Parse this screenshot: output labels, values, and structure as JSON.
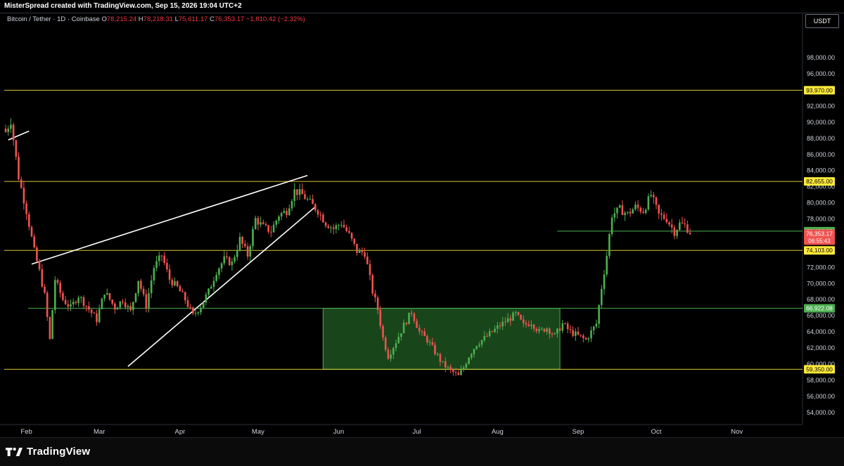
{
  "header": {
    "credit": "MisterSpread created with TradingView.com, Sep 15, 2026 19:04 UTC+2"
  },
  "legend": {
    "symbol": "Bitcoin / Tether · 1D · Coinbase",
    "open_label": "O",
    "open": "78,215.24",
    "high_label": "H",
    "high": "78,218.31",
    "low_label": "L",
    "low": "75,611.17",
    "close_label": "C",
    "close": "76,353.17",
    "change": "−1,810.42 (−2.32%)"
  },
  "currency": "USDT",
  "colors": {
    "up": "#26a69a",
    "up_candle": "#4caf50",
    "down": "#ef5350",
    "level_yellow": "#ffeb3b",
    "level_green": "#4caf50",
    "zone_fill": "#2e7d32",
    "trendline": "#ffffff",
    "background": "#000000",
    "axis_text": "#d1d4dc"
  },
  "chart_data": {
    "type": "candlestick",
    "title": "",
    "y_range": [
      52500,
      101500
    ],
    "y_ticks": [
      "54,000.00",
      "56,000.00",
      "58,000.00",
      "60,000.00",
      "62,000.00",
      "64,000.00",
      "66,000.00",
      "68,000.00",
      "70,000.00",
      "72,000.00",
      "74,000.00",
      "76,000.00",
      "78,000.00",
      "80,000.00",
      "82,000.00",
      "84,000.00",
      "86,000.00",
      "88,000.00",
      "90,000.00",
      "92,000.00",
      "94,000.00",
      "96,000.00",
      "98,000.00"
    ],
    "x_ticks": [
      "Feb",
      "Mar",
      "Apr",
      "May",
      "Jun",
      "Jul",
      "Aug",
      "Sep",
      "Oct",
      "Nov"
    ],
    "price_levels": [
      {
        "label": "93,970.00",
        "value": 93970,
        "color": "yellow"
      },
      {
        "label": "82,655.00",
        "value": 82655,
        "color": "yellow"
      },
      {
        "label": "74,103.00",
        "value": 74103,
        "color": "yellow"
      },
      {
        "label": "66,922.08",
        "value": 66922.08,
        "color": "green"
      },
      {
        "label": "59,350.00",
        "value": 59350,
        "color": "yellow"
      }
    ],
    "horizontal_ray": {
      "label": "76,492.03",
      "value": 76492.03,
      "start_date": "2026-08-24"
    },
    "last_price": {
      "label": "76,353.17",
      "value": 76353.17,
      "countdown": "06:55:43"
    },
    "zone": {
      "start_date": "2026-05-26",
      "end_date": "2026-08-25",
      "low": 59350,
      "high": 66922.08
    },
    "trendlines": [
      {
        "from": {
          "date": "2026-01-25",
          "price": 87800
        },
        "to": {
          "date": "2026-02-02",
          "price": 88900
        }
      },
      {
        "from": {
          "date": "2026-02-03",
          "price": 72400
        },
        "to": {
          "date": "2026-05-20",
          "price": 83400
        }
      },
      {
        "from": {
          "date": "2026-03-12",
          "price": 59700
        },
        "to": {
          "date": "2026-05-23",
          "price": 79500
        }
      }
    ],
    "candles_anchor": {
      "start_date": "2026-01-24"
    },
    "close_anchors": [
      [
        0,
        88800
      ],
      [
        2,
        90200
      ],
      [
        5,
        83200
      ],
      [
        8,
        79000
      ],
      [
        11,
        74000
      ],
      [
        13,
        71500
      ],
      [
        15,
        68500
      ],
      [
        17,
        63000
      ],
      [
        19,
        70500
      ],
      [
        22,
        68000
      ],
      [
        25,
        67000
      ],
      [
        28,
        68500
      ],
      [
        32,
        66800
      ],
      [
        35,
        65500
      ],
      [
        38,
        69000
      ],
      [
        42,
        67000
      ],
      [
        45,
        68000
      ],
      [
        48,
        66500
      ],
      [
        51,
        70500
      ],
      [
        54,
        67200
      ],
      [
        57,
        72000
      ],
      [
        60,
        73500
      ],
      [
        63,
        70500
      ],
      [
        66,
        69500
      ],
      [
        69,
        68000
      ],
      [
        72,
        66000
      ],
      [
        75,
        67200
      ],
      [
        78,
        69000
      ],
      [
        81,
        71500
      ],
      [
        84,
        73000
      ],
      [
        87,
        72500
      ],
      [
        90,
        75500
      ],
      [
        93,
        73500
      ],
      [
        96,
        78000
      ],
      [
        99,
        77000
      ],
      [
        102,
        76500
      ],
      [
        105,
        78500
      ],
      [
        108,
        79000
      ],
      [
        111,
        81500
      ],
      [
        114,
        81000
      ],
      [
        117,
        80000
      ],
      [
        120,
        79000
      ],
      [
        123,
        77500
      ],
      [
        126,
        76800
      ],
      [
        129,
        77500
      ],
      [
        132,
        76000
      ],
      [
        135,
        74000
      ],
      [
        138,
        73800
      ],
      [
        141,
        69000
      ],
      [
        143,
        66800
      ],
      [
        145,
        63200
      ],
      [
        147,
        61000
      ],
      [
        150,
        62800
      ],
      [
        153,
        64800
      ],
      [
        156,
        66500
      ],
      [
        159,
        64000
      ],
      [
        162,
        63000
      ],
      [
        165,
        61500
      ],
      [
        168,
        60000
      ],
      [
        171,
        59200
      ],
      [
        174,
        58500
      ],
      [
        176,
        59600
      ],
      [
        178,
        61000
      ],
      [
        181,
        62500
      ],
      [
        184,
        63200
      ],
      [
        187,
        64000
      ],
      [
        190,
        64800
      ],
      [
        193,
        65500
      ],
      [
        196,
        66200
      ],
      [
        199,
        64800
      ],
      [
        202,
        65200
      ],
      [
        205,
        64000
      ],
      [
        208,
        64500
      ],
      [
        211,
        63500
      ],
      [
        214,
        65000
      ],
      [
        217,
        64000
      ],
      [
        220,
        63500
      ],
      [
        223,
        63000
      ],
      [
        225,
        64000
      ],
      [
        227,
        65000
      ],
      [
        229,
        69500
      ],
      [
        231,
        73500
      ],
      [
        233,
        78500
      ],
      [
        236,
        79200
      ],
      [
        239,
        78600
      ],
      [
        242,
        79500
      ],
      [
        245,
        79000
      ],
      [
        248,
        81000
      ],
      [
        251,
        78500
      ],
      [
        254,
        78000
      ],
      [
        257,
        76400
      ],
      [
        259,
        77400
      ],
      [
        261,
        77200
      ],
      [
        263,
        76353
      ]
    ]
  }
}
